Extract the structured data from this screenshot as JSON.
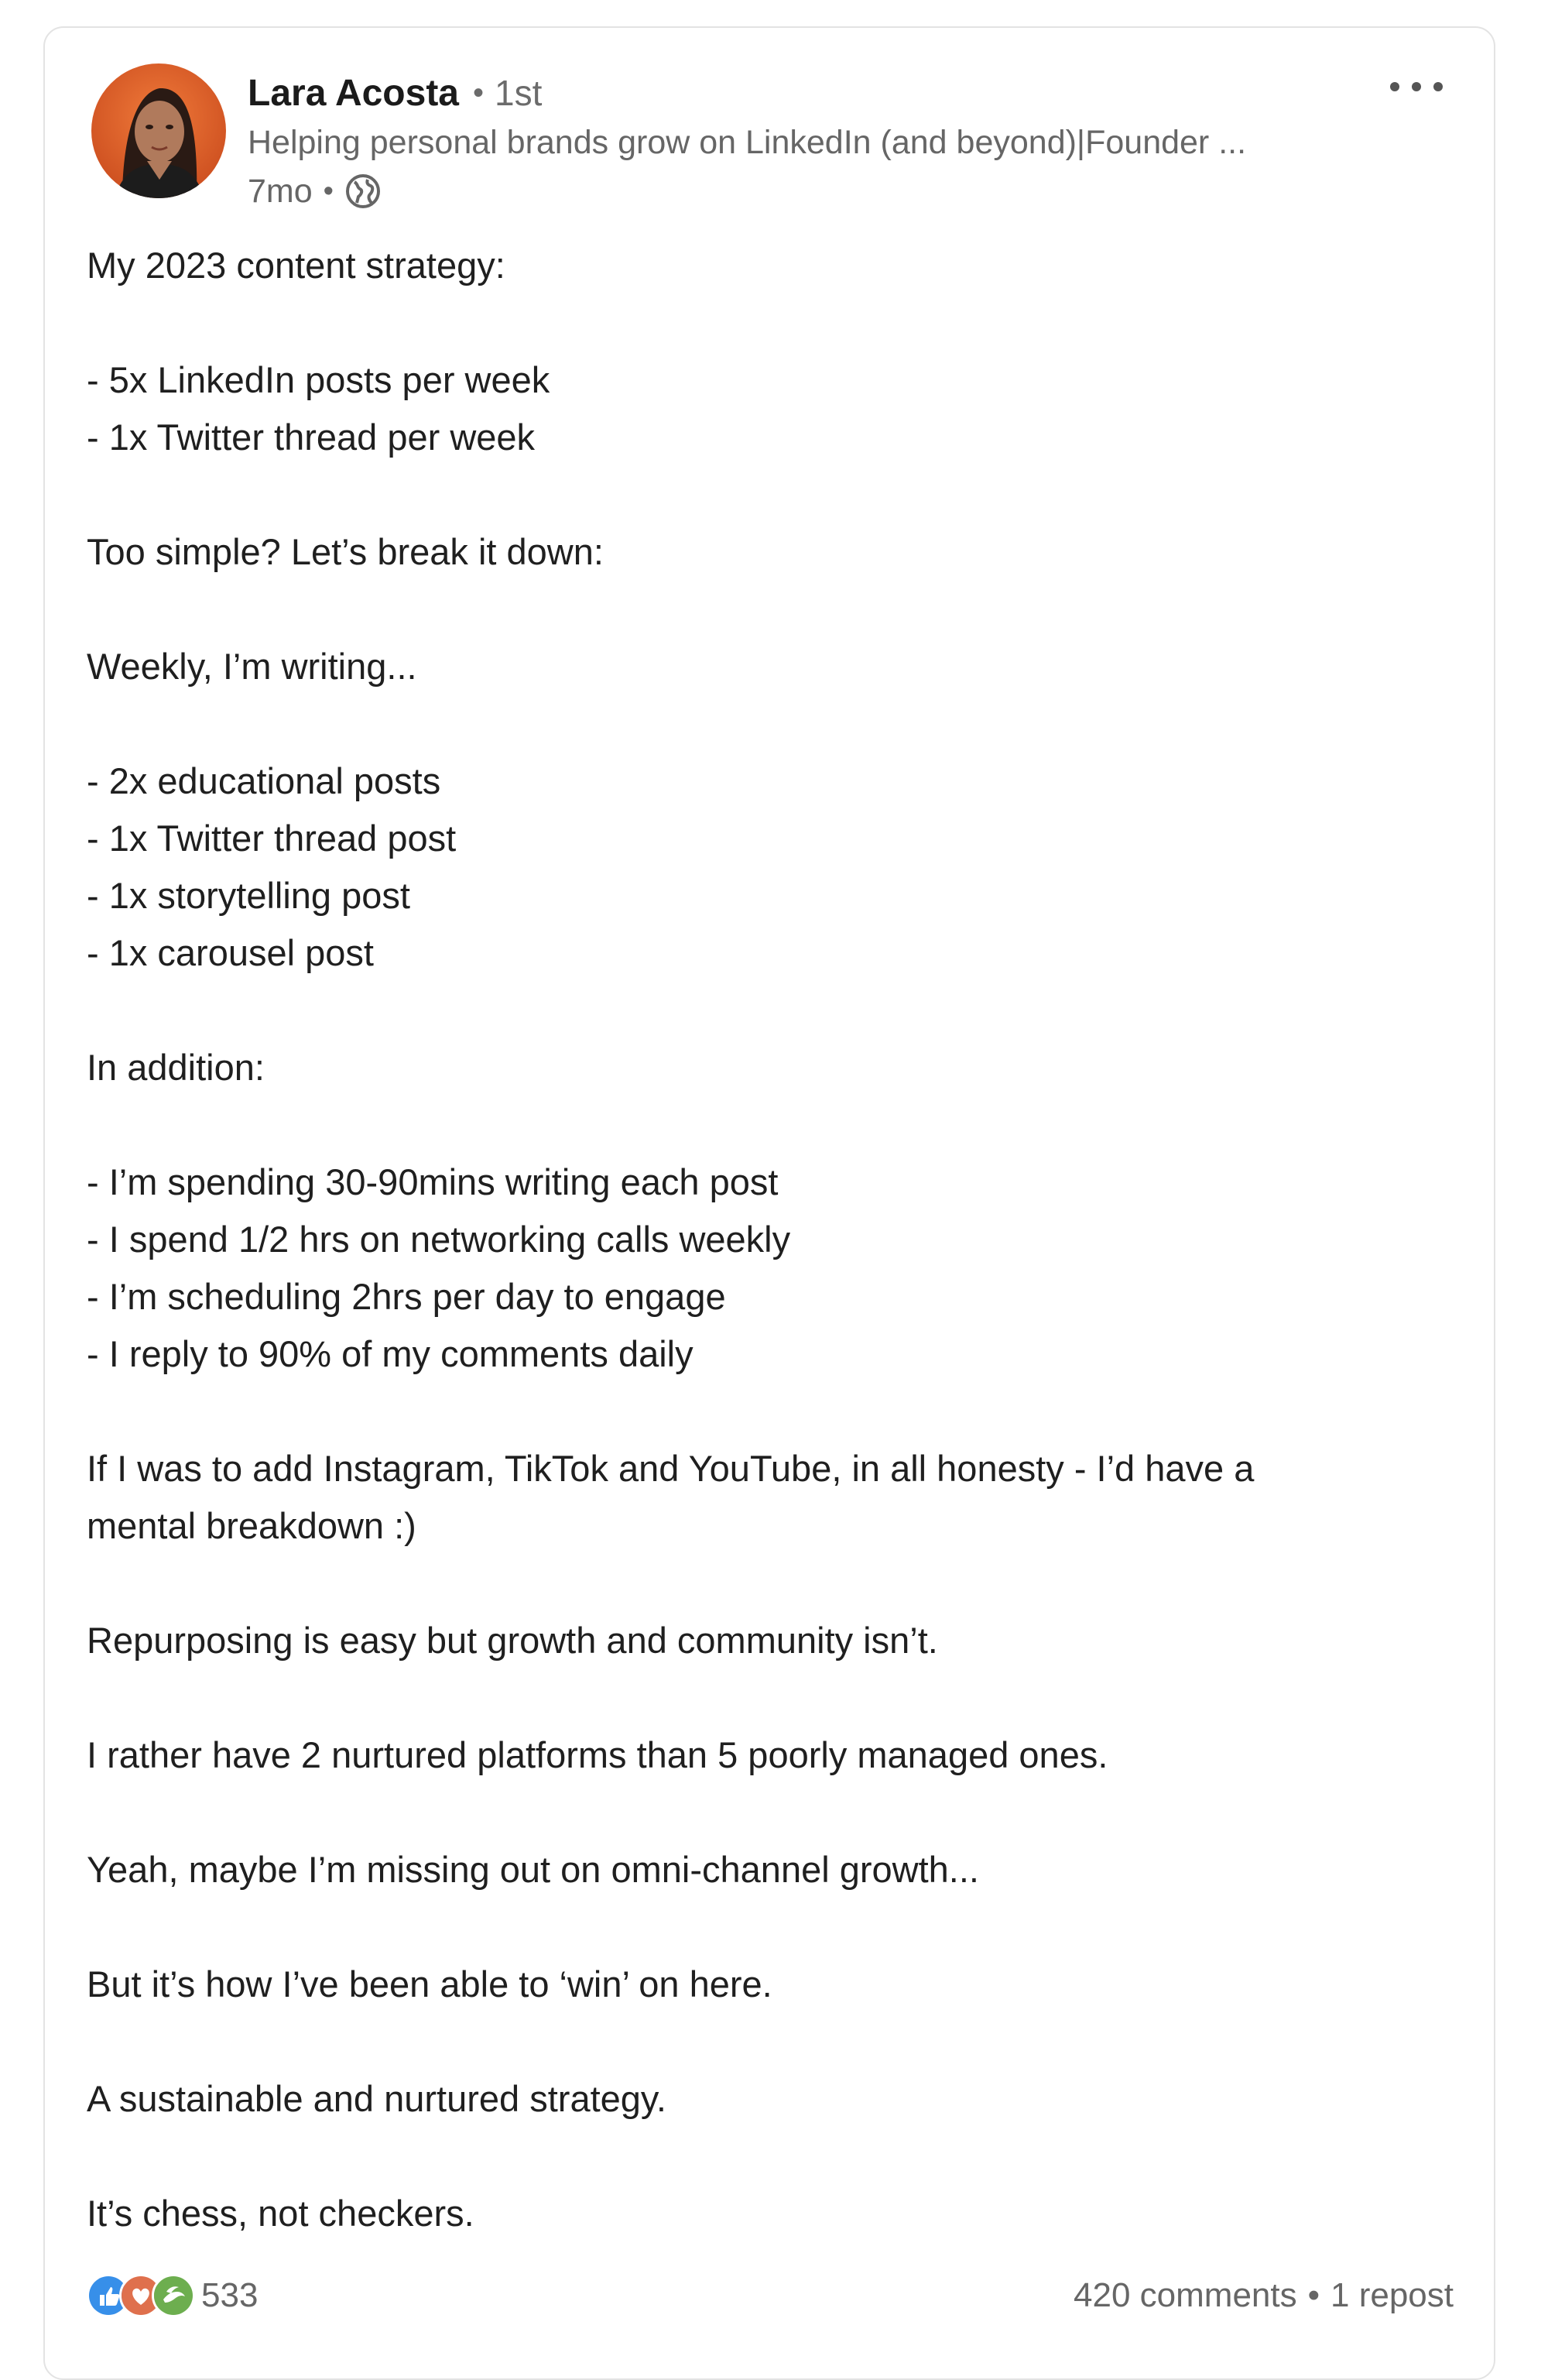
{
  "author": {
    "name": "Lara Acosta",
    "degree_separator": "•",
    "degree": "1st",
    "headline": "Helping personal brands grow on LinkedIn (and beyond)|Founder ...",
    "post_age": "7mo",
    "meta_separator": "•",
    "visibility_icon": "globe-icon"
  },
  "menu": {
    "icon": "more-horizontal-icon"
  },
  "post": {
    "lines": [
      "My 2023 content strategy:",
      "",
      "- 5x LinkedIn posts per week",
      "- 1x Twitter thread per week",
      "",
      "Too simple? Let’s break it down:",
      "",
      "Weekly, I’m writing...",
      "",
      "- 2x educational posts",
      "- 1x Twitter thread post",
      "- 1x storytelling post",
      "- 1x carousel post",
      "",
      "In addition:",
      "",
      "- I’m spending 30-90mins writing each post",
      "- I spend 1/2 hrs on networking calls weekly",
      "- I’m scheduling 2hrs per day to engage",
      "- I reply to 90% of my comments daily",
      "",
      "If I was to add Instagram, TikTok and YouTube, in all honesty - I’d have a",
      "mental breakdown :)",
      "",
      "Repurposing is easy but growth and community isn’t.",
      "",
      "I rather have 2 nurtured platforms than 5 poorly managed ones.",
      "",
      "Yeah, maybe I’m missing out on omni-channel growth...",
      "",
      "But it’s how I’ve been able to ‘win’ on here.",
      "",
      "A sustainable and nurtured strategy.",
      "",
      "It’s chess, not checkers."
    ]
  },
  "social": {
    "reaction_icons": [
      "like-icon",
      "love-icon",
      "support-icon"
    ],
    "reaction_colors": {
      "like": "#378fe9",
      "love": "#df704d",
      "support": "#6dae4f"
    },
    "reaction_count": "533",
    "comments": "420 comments",
    "separator": "•",
    "reposts": "1 repost"
  }
}
